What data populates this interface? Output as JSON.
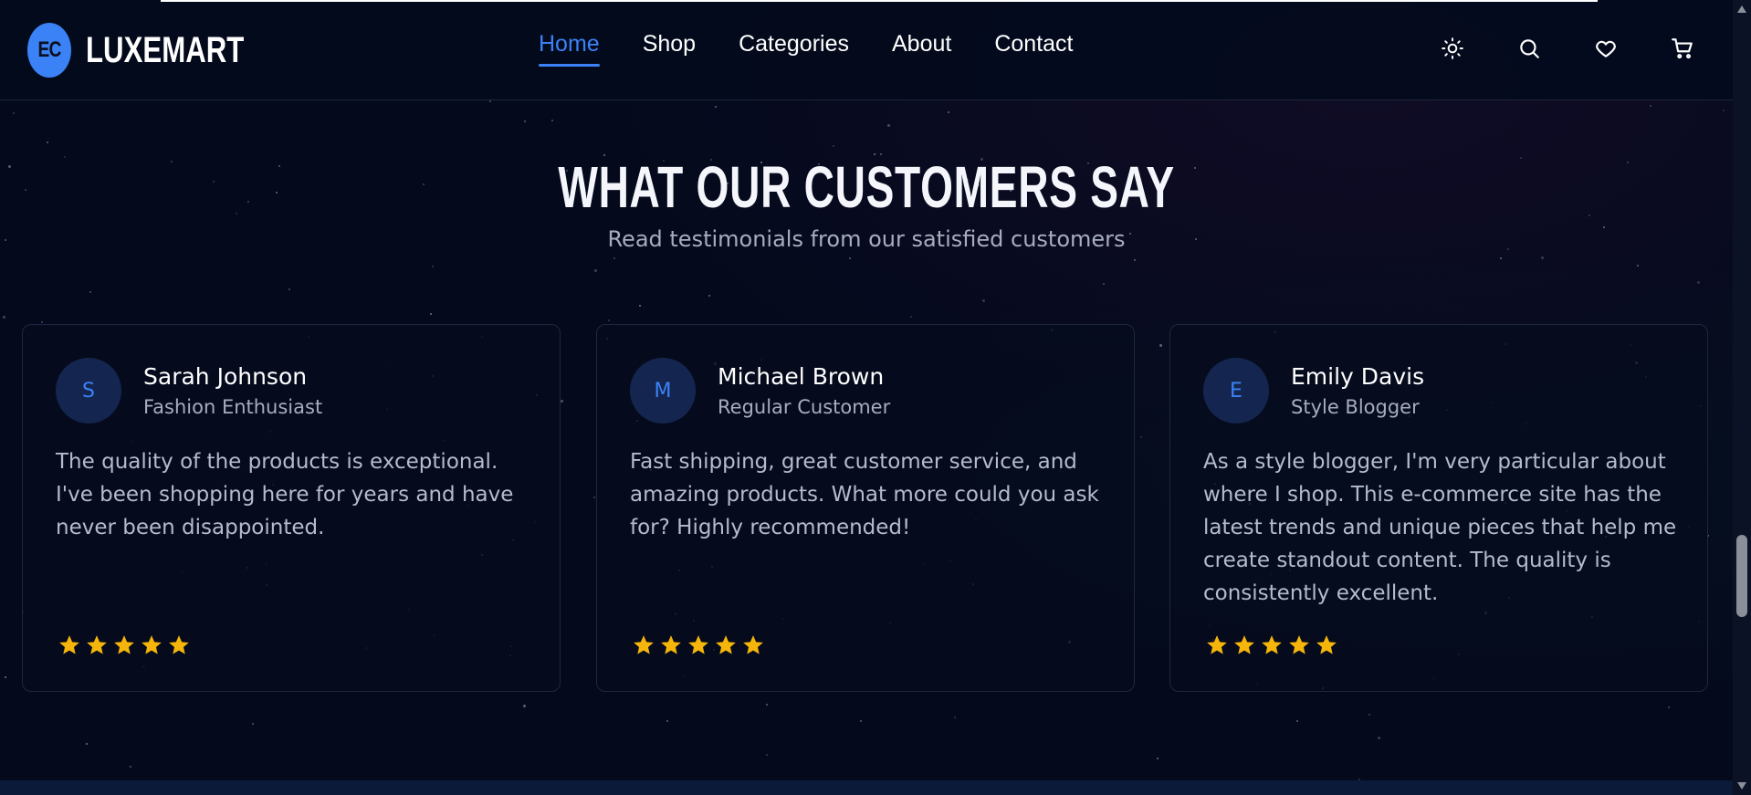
{
  "brand": {
    "badge": "EC",
    "name": "LUXEMART",
    "accent": "#3b82f6"
  },
  "nav": {
    "items": [
      {
        "label": "Home",
        "active": true
      },
      {
        "label": "Shop",
        "active": false
      },
      {
        "label": "Categories",
        "active": false
      },
      {
        "label": "About",
        "active": false
      },
      {
        "label": "Contact",
        "active": false
      }
    ]
  },
  "header_icons": [
    "sun-icon",
    "search-icon",
    "heart-icon",
    "cart-icon"
  ],
  "section": {
    "title": "WHAT OUR CUSTOMERS SAY",
    "subtitle": "Read testimonials from our satisfied customers"
  },
  "testimonials": [
    {
      "initial": "S",
      "name": "Sarah Johnson",
      "role": "Fashion Enthusiast",
      "text": "The quality of the products is exceptional. I've been shopping here for years and have never been disappointed.",
      "rating": 5
    },
    {
      "initial": "M",
      "name": "Michael Brown",
      "role": "Regular Customer",
      "text": "Fast shipping, great customer service, and amazing products. What more could you ask for? Highly recommended!",
      "rating": 5
    },
    {
      "initial": "E",
      "name": "Emily Davis",
      "role": "Style Blogger",
      "text": "As a style blogger, I'm very particular about where I shop. This e-commerce site has the latest trends and unique pieces that help me create standout content. The quality is consistently excellent.",
      "rating": 5
    }
  ],
  "colors": {
    "star": "#f5b50a",
    "background": "#040a1c",
    "avatar_bg": "#14264f"
  }
}
